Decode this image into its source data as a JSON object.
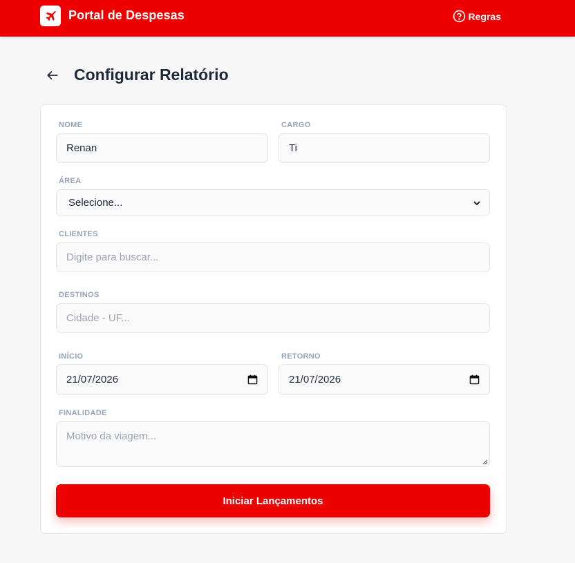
{
  "header": {
    "app_title": "Portal de Despesas",
    "logo_icon": "airplane-icon",
    "rules_label": "Regras",
    "rules_icon": "help-circle-icon",
    "brand_color": "#ee0000"
  },
  "page": {
    "title": "Configurar Relatório",
    "back_icon": "arrow-left-icon"
  },
  "form": {
    "nome": {
      "label": "NOME",
      "value": "Renan"
    },
    "cargo": {
      "label": "CARGO",
      "value": "Ti"
    },
    "area": {
      "label": "ÁREA",
      "selected": "Selecione..."
    },
    "clientes": {
      "label": "CLIENTES",
      "placeholder": "Digite para buscar..."
    },
    "destinos": {
      "label": "DESTINOS",
      "placeholder": "Cidade - UF..."
    },
    "inicio": {
      "label": "INÍCIO",
      "value": "21/07/2026"
    },
    "retorno": {
      "label": "RETORNO",
      "value": "21/07/2026"
    },
    "finalidade": {
      "label": "FINALIDADE",
      "placeholder": "Motivo da viagem..."
    },
    "submit_label": "Iniciar Lançamentos"
  }
}
